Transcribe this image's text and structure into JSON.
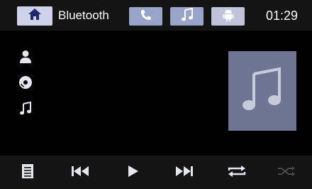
{
  "header": {
    "title": "Bluetooth",
    "clock": "01:29",
    "home_icon": "home-icon",
    "tabs": [
      {
        "id": "phone",
        "icon": "phone-icon"
      },
      {
        "id": "music",
        "icon": "music-note-icon"
      },
      {
        "id": "android",
        "icon": "android-icon"
      }
    ]
  },
  "track_info": {
    "artist_icon": "person-icon",
    "album_icon": "disc-icon",
    "title_icon": "music-note-icon",
    "artist": "",
    "album": "",
    "title": ""
  },
  "album_art": {
    "icon": "music-note-icon"
  },
  "controls": [
    {
      "id": "playlist",
      "icon": "playlist-icon"
    },
    {
      "id": "previous",
      "icon": "previous-track-icon"
    },
    {
      "id": "play",
      "icon": "play-icon"
    },
    {
      "id": "next",
      "icon": "next-track-icon"
    },
    {
      "id": "repeat",
      "icon": "repeat-icon"
    },
    {
      "id": "shuffle",
      "icon": "shuffle-icon",
      "state": "disabled"
    }
  ],
  "colors": {
    "background": "#000000",
    "bar": "#141414",
    "tab_active": "#9aa3c8",
    "home_button": "#cfd2e8",
    "album_art_bg": "#6e7594",
    "icon_light": "#e6e6ee",
    "icon_dim": "#4a4a52"
  }
}
